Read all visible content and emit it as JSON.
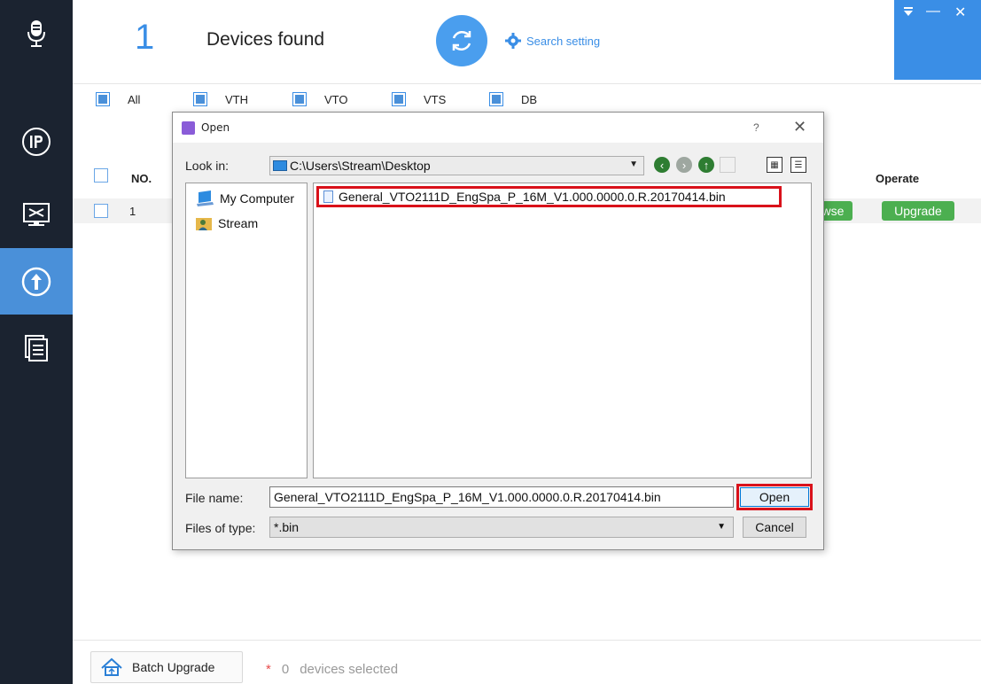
{
  "header": {
    "device_count": "1",
    "devices_found_label": "Devices found",
    "search_setting_label": "Search setting"
  },
  "filters": [
    {
      "label": "All",
      "checked": true
    },
    {
      "label": "VTH",
      "checked": true
    },
    {
      "label": "VTO",
      "checked": true
    },
    {
      "label": "VTS",
      "checked": true
    },
    {
      "label": "DB",
      "checked": true
    }
  ],
  "table": {
    "col_no": "NO.",
    "col_operate": "Operate",
    "rows": [
      {
        "no": "1",
        "browse_label": "wse",
        "upgrade_label": "Upgrade"
      }
    ]
  },
  "footer": {
    "batch_upgrade_label": "Batch Upgrade",
    "star": "*",
    "selected_count": "0",
    "selected_label": "devices selected"
  },
  "dialog": {
    "title": "Open",
    "help": "?",
    "close": "✕",
    "look_in_label": "Look in:",
    "look_in_path": "C:\\Users\\Stream\\Desktop",
    "places": [
      {
        "label": "My Computer",
        "icon": "computer-icon"
      },
      {
        "label": "Stream",
        "icon": "user-folder-icon"
      }
    ],
    "files": [
      {
        "name": "General_VTO2111D_EngSpa_P_16M_V1.000.0000.0.R.20170414.bin",
        "highlighted": true
      }
    ],
    "file_name_label": "File name:",
    "file_name_value": "General_VTO2111D_EngSpa_P_16M_V1.000.0000.0.R.20170414.bin",
    "files_of_type_label": "Files of type:",
    "files_of_type_value": "*.bin",
    "open_label": "Open",
    "cancel_label": "Cancel"
  },
  "colors": {
    "accent": "#3a8ee6",
    "sidebar": "#1b2330",
    "green": "#4caf50",
    "highlight_red": "#d9111a"
  }
}
